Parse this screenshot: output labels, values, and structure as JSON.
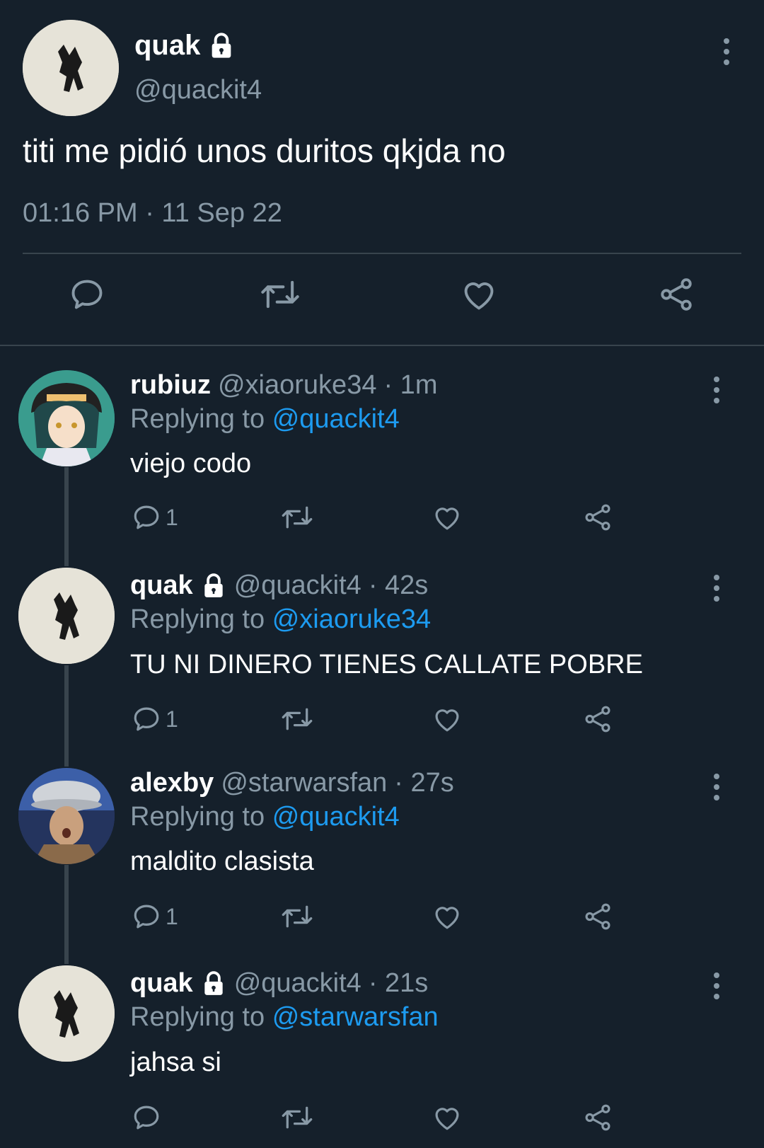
{
  "main_tweet": {
    "name": "quak",
    "handle": "@quackit4",
    "text": "titi me pidió unos duritos qkjda no",
    "timestamp": "01:16 PM · 11 Sep 22",
    "locked": true
  },
  "replies": [
    {
      "name": "rubiuz",
      "handle": "@xiaoruke34",
      "time": "· 1m",
      "replying_prefix": "Replying to",
      "replying_to": "@quackit4",
      "text": "viejo codo",
      "reply_count": "1",
      "locked": false
    },
    {
      "name": "quak",
      "handle": "@quackit4",
      "time": "· 42s",
      "replying_prefix": "Replying to",
      "replying_to": "@xiaoruke34",
      "text": "TU NI DINERO TIENES CALLATE POBRE",
      "reply_count": "1",
      "locked": true
    },
    {
      "name": "alexby",
      "handle": "@starwarsfan",
      "time": "· 27s",
      "replying_prefix": "Replying to",
      "replying_to": "@quackit4",
      "text": "maldito clasista",
      "reply_count": "1",
      "locked": false
    },
    {
      "name": "quak",
      "handle": "@quackit4",
      "time": "· 21s",
      "replying_prefix": "Replying to",
      "replying_to": "@starwarsfan",
      "text": "jahsa si",
      "reply_count": "",
      "locked": true
    }
  ],
  "colors": {
    "background": "#15202b",
    "muted": "#8899a6",
    "link": "#1d9bf0",
    "divider": "#38444d"
  },
  "icons": [
    "reply-icon",
    "retweet-icon",
    "like-icon",
    "share-icon",
    "more-icon",
    "lock-icon"
  ]
}
